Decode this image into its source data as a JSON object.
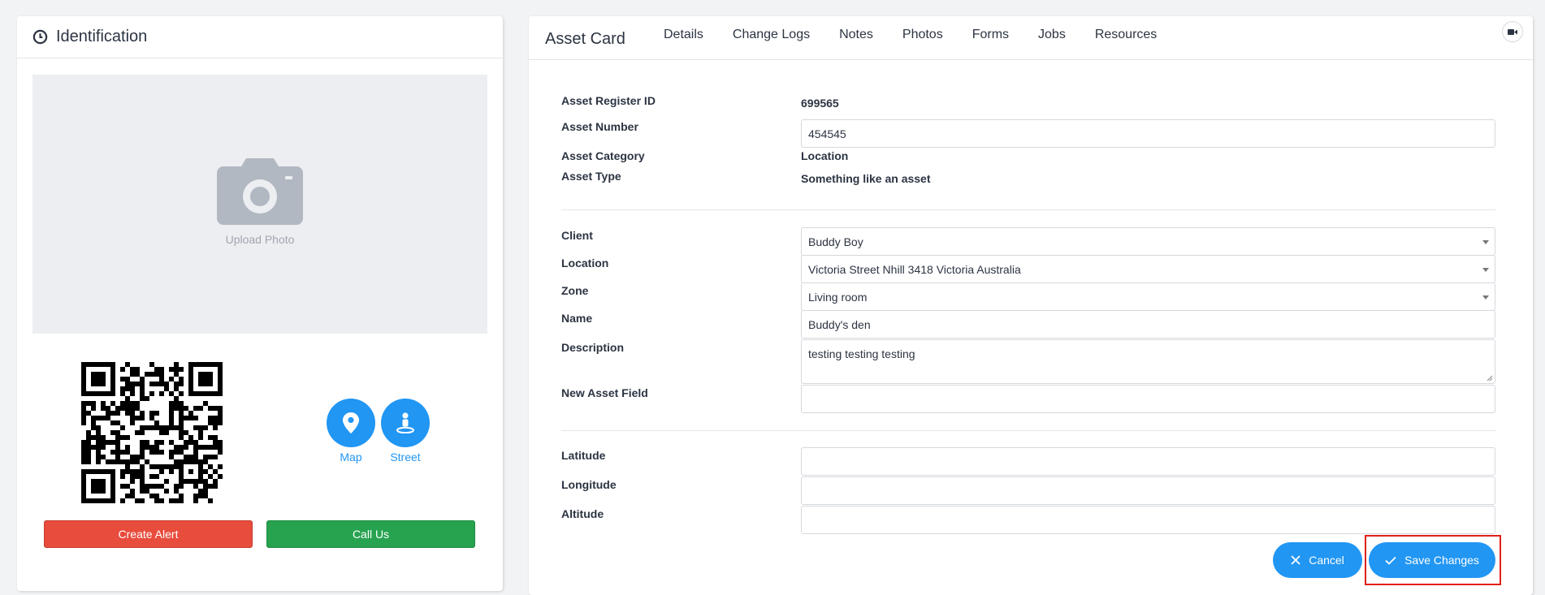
{
  "identification": {
    "title": "Identification",
    "upload_label": "Upload Photo",
    "map_label": "Map",
    "street_label": "Street",
    "create_alert_label": "Create Alert",
    "call_us_label": "Call Us"
  },
  "asset_card": {
    "title": "Asset Card",
    "tabs": [
      {
        "label": "Details",
        "active": true
      },
      {
        "label": "Change Logs",
        "active": false
      },
      {
        "label": "Notes",
        "active": false
      },
      {
        "label": "Photos",
        "active": false
      },
      {
        "label": "Forms",
        "active": false
      },
      {
        "label": "Jobs",
        "active": false
      },
      {
        "label": "Resources",
        "active": false
      }
    ],
    "labels": {
      "asset_register_id": "Asset Register ID",
      "asset_number": "Asset Number",
      "asset_category": "Asset Category",
      "asset_type": "Asset Type",
      "client": "Client",
      "location": "Location",
      "zone": "Zone",
      "name": "Name",
      "description": "Description",
      "new_asset_field": "New Asset Field",
      "latitude": "Latitude",
      "longitude": "Longitude",
      "altitude": "Altitude"
    },
    "values": {
      "asset_register_id": "699565",
      "asset_number": "454545",
      "asset_category": "Location",
      "asset_type": "Something like an asset",
      "client": "Buddy Boy",
      "location": "Victoria Street Nhill 3418 Victoria Australia",
      "zone": "Living room",
      "name": "Buddy's den",
      "description": "testing testing testing",
      "new_asset_field": "",
      "latitude": "",
      "longitude": "",
      "altitude": ""
    },
    "cancel_label": "Cancel",
    "save_label": "Save Changes"
  },
  "colors": {
    "primary": "#2196f3",
    "danger": "#e84c3d",
    "success": "#27a350",
    "highlight": "#e0201a"
  }
}
